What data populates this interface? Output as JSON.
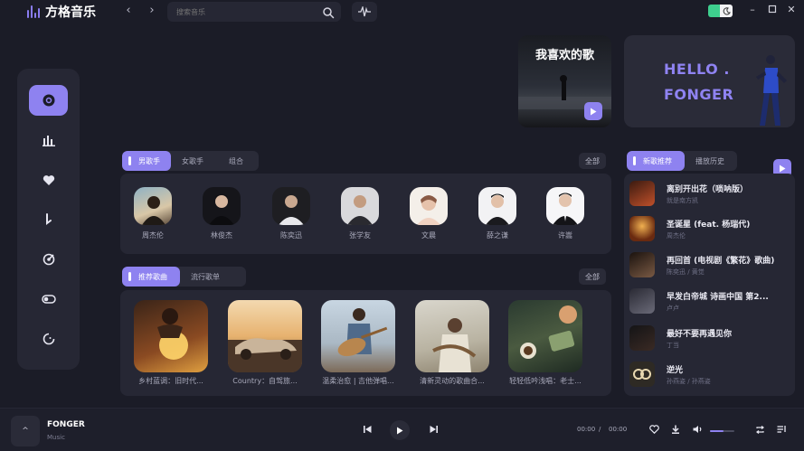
{
  "app": {
    "name": "方格音乐"
  },
  "search": {
    "placeholder": "搜索音乐"
  },
  "banner": {
    "favorite_title": "我喜欢的歌",
    "hello_line1": "HELLO .",
    "hello_line2": "FONGER"
  },
  "singers_section": {
    "tabs": [
      {
        "label": "男歌手",
        "active": true
      },
      {
        "label": "女歌手",
        "active": false
      },
      {
        "label": "组合",
        "active": false
      }
    ],
    "all_label": "全部",
    "singers": [
      {
        "name": "周杰伦"
      },
      {
        "name": "林俊杰"
      },
      {
        "name": "陈奕迅"
      },
      {
        "name": "张学友"
      },
      {
        "name": "文晨"
      },
      {
        "name": "薛之谦"
      },
      {
        "name": "许嵩"
      }
    ]
  },
  "songs_section": {
    "tabs": [
      {
        "label": "推荐歌曲",
        "active": true
      },
      {
        "label": "流行歌单",
        "active": false
      }
    ],
    "all_label": "全部",
    "playlists": [
      {
        "title": "乡村蓝调：旧时代..."
      },
      {
        "title": "Country：自驾旅..."
      },
      {
        "title": "温柔治愈 | 吉他弹唱..."
      },
      {
        "title": "清新灵动的歌曲合..."
      },
      {
        "title": "轻轻低吟浅唱：老士..."
      }
    ]
  },
  "right_panel": {
    "tabs": [
      {
        "label": "新歌推荐",
        "active": true
      },
      {
        "label": "播放历史",
        "active": false
      }
    ],
    "tracks": [
      {
        "title": "离别开出花（唢呐版）",
        "artist": "就是南方凯"
      },
      {
        "title": "圣诞星 (feat. 杨瑞代)",
        "artist": "周杰伦"
      },
      {
        "title": "再回首 (电视剧《繁花》歌曲)",
        "artist": "陈奕迅 / 黄觉"
      },
      {
        "title": "早发白帝城 诗画中国 第2...",
        "artist": "卢卢"
      },
      {
        "title": "最好不要再遇见你",
        "artist": "丁当"
      },
      {
        "title": "逆光",
        "artist": "孙燕姿 / 孙燕姿"
      }
    ]
  },
  "player": {
    "expand_label": "^",
    "now_title": "FONGER",
    "now_subtitle": "Music",
    "current_time": "00:00",
    "separator": "/",
    "total_time": "00:00",
    "volume": 0.55
  },
  "colors": {
    "accent": "#8e82f0",
    "background": "#1b1c27",
    "panel": "#262734",
    "toggle_green": "#3ecf8e"
  }
}
